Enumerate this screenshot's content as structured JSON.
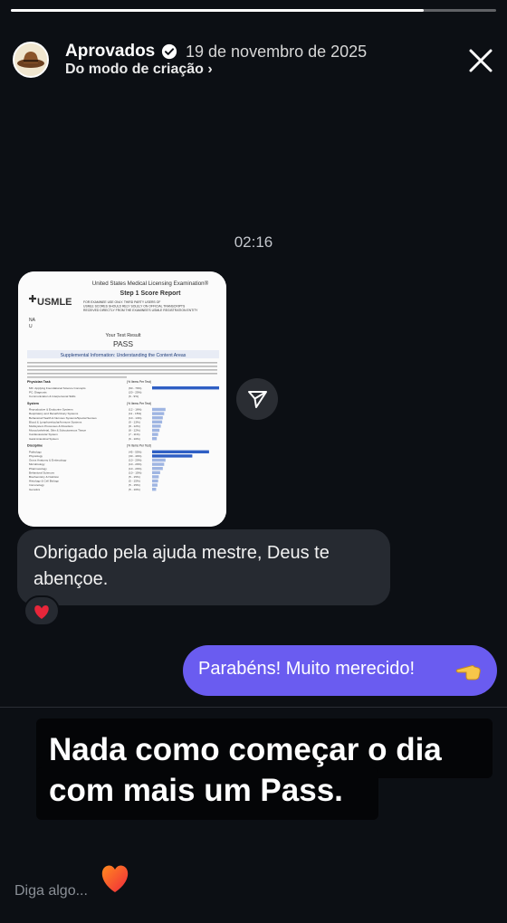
{
  "story": {
    "progress_fraction": 0.85,
    "account_name": "Aprovados",
    "post_date": "19 de novembro de 2025",
    "subtitle": "Do modo de criação ›"
  },
  "chat": {
    "timestamp": "02:16",
    "incoming_message": "Obrigado pela ajuda mestre, Deus te abençoe.",
    "reaction_emoji": "heart-icon",
    "outgoing_message": "Parabéns! Muito merecido!"
  },
  "score_report": {
    "header_line": "United States Medical Licensing Examination®",
    "title": "Step 1 Score Report",
    "logo": "USMLE",
    "notice": "FOR EXAMINEE USE ONLY. THIRD PARTY USERS OF USMLE SCORES SHOULD RELY SOLELY ON OFFICIAL TRANSCRIPTS RECEIVED DIRECTLY FROM THE EXAMINEE'S USMLE REGISTRATION ENTITY",
    "result_label": "Your Test Result",
    "result": "PASS",
    "section_title": "Supplemental Information: Understanding the Content Areas",
    "groups": [
      {
        "heading": "Physician Task",
        "col": "(% Items Per Test)",
        "rows": [
          {
            "label": "MK: Applying Foundational Science Concepts",
            "range": "(60 - 70%)",
            "bar": 1.0
          },
          {
            "label": "PC: Diagnosis",
            "range": "(20 - 25%)",
            "bar": 0.0
          },
          {
            "label": "Communication & Interpersonal Skills",
            "range": "(6 - 9%)",
            "bar": 0.0
          }
        ]
      },
      {
        "heading": "System",
        "col": "(% Items Per Test)",
        "rows": [
          {
            "label": "Reproductive & Endocrine Systems",
            "range": "(12 - 16%)",
            "bar": 0.2
          },
          {
            "label": "Respiratory and Renal/Urinary Systems",
            "range": "(11 - 15%)",
            "bar": 0.18
          },
          {
            "label": "Behavioral Health & Nervous Systems/Special Senses",
            "range": "(10 - 14%)",
            "bar": 0.16
          },
          {
            "label": "Blood & Lymphoreticular/Immune Systems",
            "range": "(9 - 13%)",
            "bar": 0.15
          },
          {
            "label": "Multisystem Processes & Disorders",
            "range": "(8 - 12%)",
            "bar": 0.13
          },
          {
            "label": "Musculoskeletal, Skin & Subcutaneous Tissue",
            "range": "(8 - 12%)",
            "bar": 0.11
          },
          {
            "label": "Cardiovascular System",
            "range": "(7 - 11%)",
            "bar": 0.09
          },
          {
            "label": "Gastrointestinal System",
            "range": "(6 - 10%)",
            "bar": 0.07
          }
        ]
      },
      {
        "heading": "Discipline",
        "col": "(% Items Per Test)",
        "rows": [
          {
            "label": "Pathology",
            "range": "(45 - 55%)",
            "bar": 0.85
          },
          {
            "label": "Physiology",
            "range": "(30 - 40%)",
            "bar": 0.6
          },
          {
            "label": "Gross Anatomy & Embryology",
            "range": "(10 - 20%)",
            "bar": 0.2
          },
          {
            "label": "Microbiology",
            "range": "(10 - 20%)",
            "bar": 0.18
          },
          {
            "label": "Pharmacology",
            "range": "(10 - 20%)",
            "bar": 0.16
          },
          {
            "label": "Behavioral Sciences",
            "range": "(10 - 15%)",
            "bar": 0.12
          },
          {
            "label": "Biochemistry & Nutrition",
            "range": "(5 - 15%)",
            "bar": 0.1
          },
          {
            "label": "Histology & Cell Biology",
            "range": "(5 - 15%)",
            "bar": 0.09
          },
          {
            "label": "Immunology",
            "range": "(5 - 15%)",
            "bar": 0.08
          },
          {
            "label": "Genetics",
            "range": "(5 - 10%)",
            "bar": 0.06
          }
        ]
      }
    ]
  },
  "overlay": {
    "line1": "Nada como começar o dia",
    "line2": "com mais um Pass."
  },
  "reply": {
    "placeholder": "Diga algo..."
  },
  "colors": {
    "background": "#0c0f14",
    "incoming_bubble": "#262a31",
    "outgoing_bubble": "#6a5cf0",
    "report_bar": "#2f5fc4"
  }
}
